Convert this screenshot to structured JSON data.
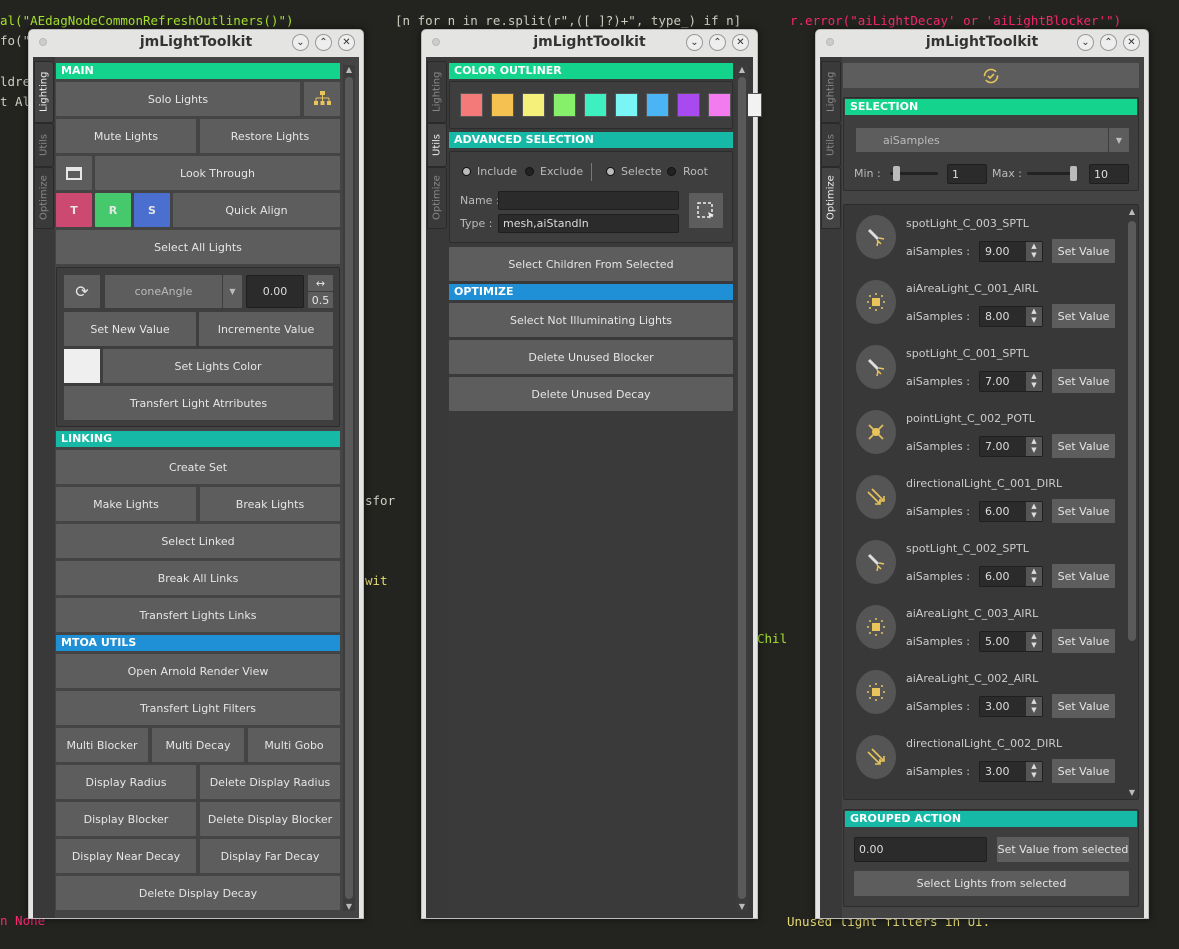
{
  "background_code": [
    "al(\"AEdagNodeCommonRefreshOutliners()\")",
    "fo(\"",
    "[n for n in re.split(r\",([ ]?)+\", type_) if n]",
    "r.error(\"aiLightDecay' or 'aiLightBlocker'\")",
    "Unused light filters in UI.",
    "n None",
    "ldre",
    "t Al",
    "wit",
    "Chil",
    "sfor"
  ],
  "colors": {
    "main_header": "#14d38c",
    "section_header": "#16b9a6",
    "blue_header": "#1f8fd6",
    "button": "#5d5d5d",
    "panel": "#444444"
  },
  "window_title": "jmLightToolkit",
  "side_tabs": [
    "Lighting",
    "Utils",
    "Optimize"
  ],
  "lighting": {
    "main_header": "MAIN",
    "solo_lights": "Solo Lights",
    "mute_lights": "Mute Lights",
    "restore_lights": "Restore Lights",
    "look_through": "Look Through",
    "t": "T",
    "r": "R",
    "s": "S",
    "quick_align": "Quick Align",
    "select_all_lights": "Select All Lights",
    "attribute": "coneAngle",
    "attribute_value": "0.00",
    "increment_step": "0.5",
    "set_new_value": "Set New Value",
    "incremente_value": "Incremente Value",
    "lights_color": "#efefef",
    "set_lights_color": "Set Lights Color",
    "transfert_light_attributes": "Transfert Light Atrributes",
    "linking_header": "LINKING",
    "create_set": "Create Set",
    "make_lights": "Make Lights",
    "break_lights": "Break Lights",
    "select_linked": "Select Linked",
    "break_all_links": "Break All Links",
    "transfert_lights_links": "Transfert Lights Links",
    "mtoa_header": "MTOA UTILS",
    "open_arnold": "Open Arnold Render View",
    "transfert_light_filters": "Transfert Light Filters",
    "multi_blocker": "Multi Blocker",
    "multi_decay": "Multi Decay",
    "multi_gobo": "Multi Gobo",
    "display_radius": "Display Radius",
    "delete_display_radius": "Delete Display Radius",
    "display_blocker": "Display Blocker",
    "delete_display_blocker": "Delete Display Blocker",
    "display_near_decay": "Display Near Decay",
    "display_far_decay": "Display Far Decay",
    "delete_display_decay": "Delete Display Decay"
  },
  "utils": {
    "color_outliner_header": "COLOR OUTLINER",
    "outliner_colors": [
      "#f47a7a",
      "#f5c150",
      "#f5f07a",
      "#87f06a",
      "#3ef0c0",
      "#7af5f5",
      "#4ab4f5",
      "#a94af0",
      "#f47af0",
      "#f2f2f2"
    ],
    "advanced_header": "ADVANCED SELECTION",
    "include": "Include",
    "exclude": "Exclude",
    "selected": "Selectec",
    "root": "Root",
    "name_label": "Name :",
    "name_value": "",
    "type_label": "Type :",
    "type_value": "mesh,aiStandIn",
    "select_children": "Select Children From Selected",
    "optimize_header": "OPTIMIZE",
    "select_not_illuminating": "Select Not Illuminating Lights",
    "delete_unused_blocker": "Delete Unused Blocker",
    "delete_unused_decay": "Delete Unused Decay"
  },
  "optimize": {
    "selection_header": "SELECTION",
    "attribute": "aiSamples",
    "min_label": "Min :",
    "min_value": "1",
    "max_label": "Max :",
    "max_value": "10",
    "lights": [
      {
        "name": "spotLight_C_003_SPTL",
        "type": "spot",
        "attr": "aiSamples :",
        "value": "9.00",
        "button": "Set Value"
      },
      {
        "name": "aiAreaLight_C_001_AIRL",
        "type": "area",
        "attr": "aiSamples :",
        "value": "8.00",
        "button": "Set Value"
      },
      {
        "name": "spotLight_C_001_SPTL",
        "type": "spot",
        "attr": "aiSamples :",
        "value": "7.00",
        "button": "Set Value"
      },
      {
        "name": "pointLight_C_002_POTL",
        "type": "point",
        "attr": "aiSamples :",
        "value": "7.00",
        "button": "Set Value"
      },
      {
        "name": "directionalLight_C_001_DIRL",
        "type": "directional",
        "attr": "aiSamples :",
        "value": "6.00",
        "button": "Set Value"
      },
      {
        "name": "spotLight_C_002_SPTL",
        "type": "spot",
        "attr": "aiSamples :",
        "value": "6.00",
        "button": "Set Value"
      },
      {
        "name": "aiAreaLight_C_003_AIRL",
        "type": "area",
        "attr": "aiSamples :",
        "value": "5.00",
        "button": "Set Value"
      },
      {
        "name": "aiAreaLight_C_002_AIRL",
        "type": "area",
        "attr": "aiSamples :",
        "value": "3.00",
        "button": "Set Value"
      },
      {
        "name": "directionalLight_C_002_DIRL",
        "type": "directional",
        "attr": "aiSamples :",
        "value": "3.00",
        "button": "Set Value"
      }
    ],
    "grouped_header": "GROUPED ACTION",
    "grouped_value": "0.00",
    "set_value_from_selected": "Set Value from selected",
    "select_lights_from_selected": "Select Lights from selected"
  }
}
